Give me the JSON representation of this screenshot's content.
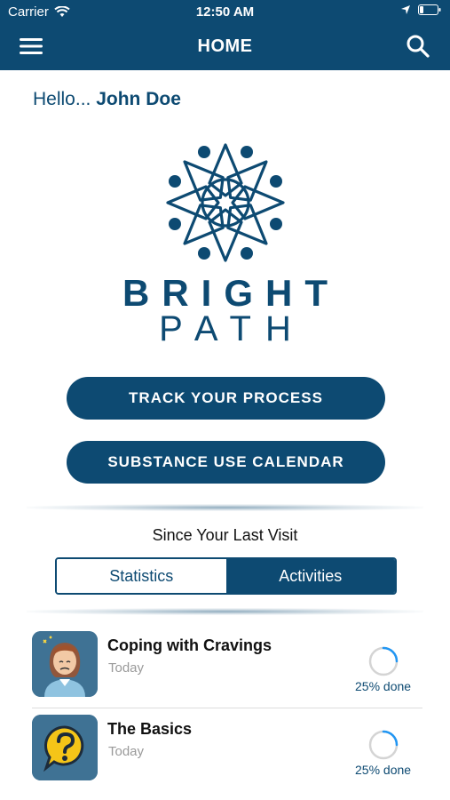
{
  "status_bar": {
    "carrier": "Carrier",
    "time": "12:50 AM"
  },
  "nav": {
    "title": "HOME",
    "menu_icon": "hamburger-menu-icon",
    "search_icon": "search-icon"
  },
  "greeting": {
    "prefix": "Hello... ",
    "name": "John Doe"
  },
  "brand": {
    "line1": "BRIGHT",
    "line2": "PATH"
  },
  "buttons": {
    "track": "TRACK YOUR PROCESS",
    "calendar": "SUBSTANCE USE CALENDAR"
  },
  "since_label": "Since Your Last Visit",
  "tabs": [
    {
      "label": "Statistics",
      "active": false
    },
    {
      "label": "Activities",
      "active": true
    }
  ],
  "activities": [
    {
      "title": "Coping with Cravings",
      "date": "Today",
      "progress_label": "25% done",
      "progress": 0.25,
      "icon": "stressed-person-icon"
    },
    {
      "title": "The Basics",
      "date": "Today",
      "progress_label": "25% done",
      "progress": 0.25,
      "icon": "question-bubble-icon"
    }
  ],
  "colors": {
    "primary": "#0d4a72",
    "thumb_bg": "#3f7294",
    "muted": "#9a9a9a"
  }
}
